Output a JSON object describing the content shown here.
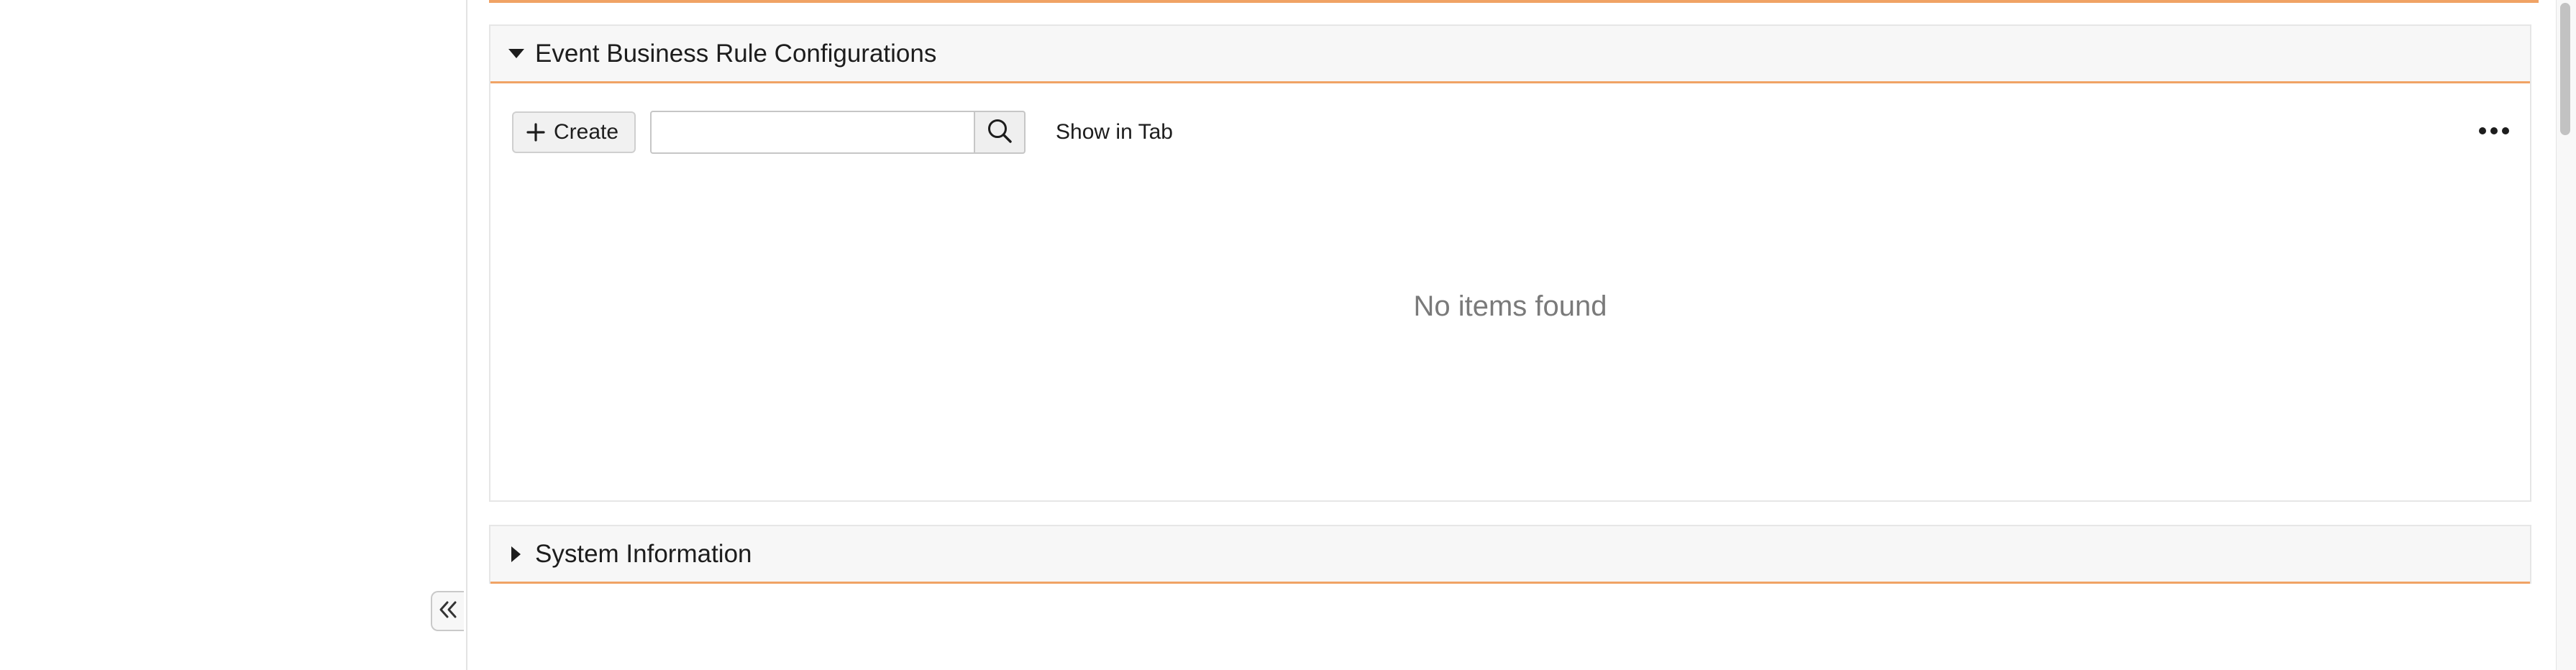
{
  "sections": {
    "event_rules": {
      "title": "Event Business Rule Configurations",
      "expanded": true,
      "toolbar": {
        "create_label": "Create",
        "search_value": "",
        "search_placeholder": "",
        "show_in_tab_label": "Show in Tab"
      },
      "empty_message": "No items found"
    },
    "system_info": {
      "title": "System Information",
      "expanded": false
    }
  },
  "icons": {
    "expanded_caret": "caret-down-icon",
    "collapsed_caret": "caret-right-icon",
    "create": "plus-icon",
    "search": "search-icon",
    "more": "more-horizontal-icon",
    "collapse_panel": "double-chevron-left-icon"
  },
  "colors": {
    "accent": "#f0a365",
    "header_background": "#f7f7f7",
    "muted_text": "#7a7a7a"
  }
}
